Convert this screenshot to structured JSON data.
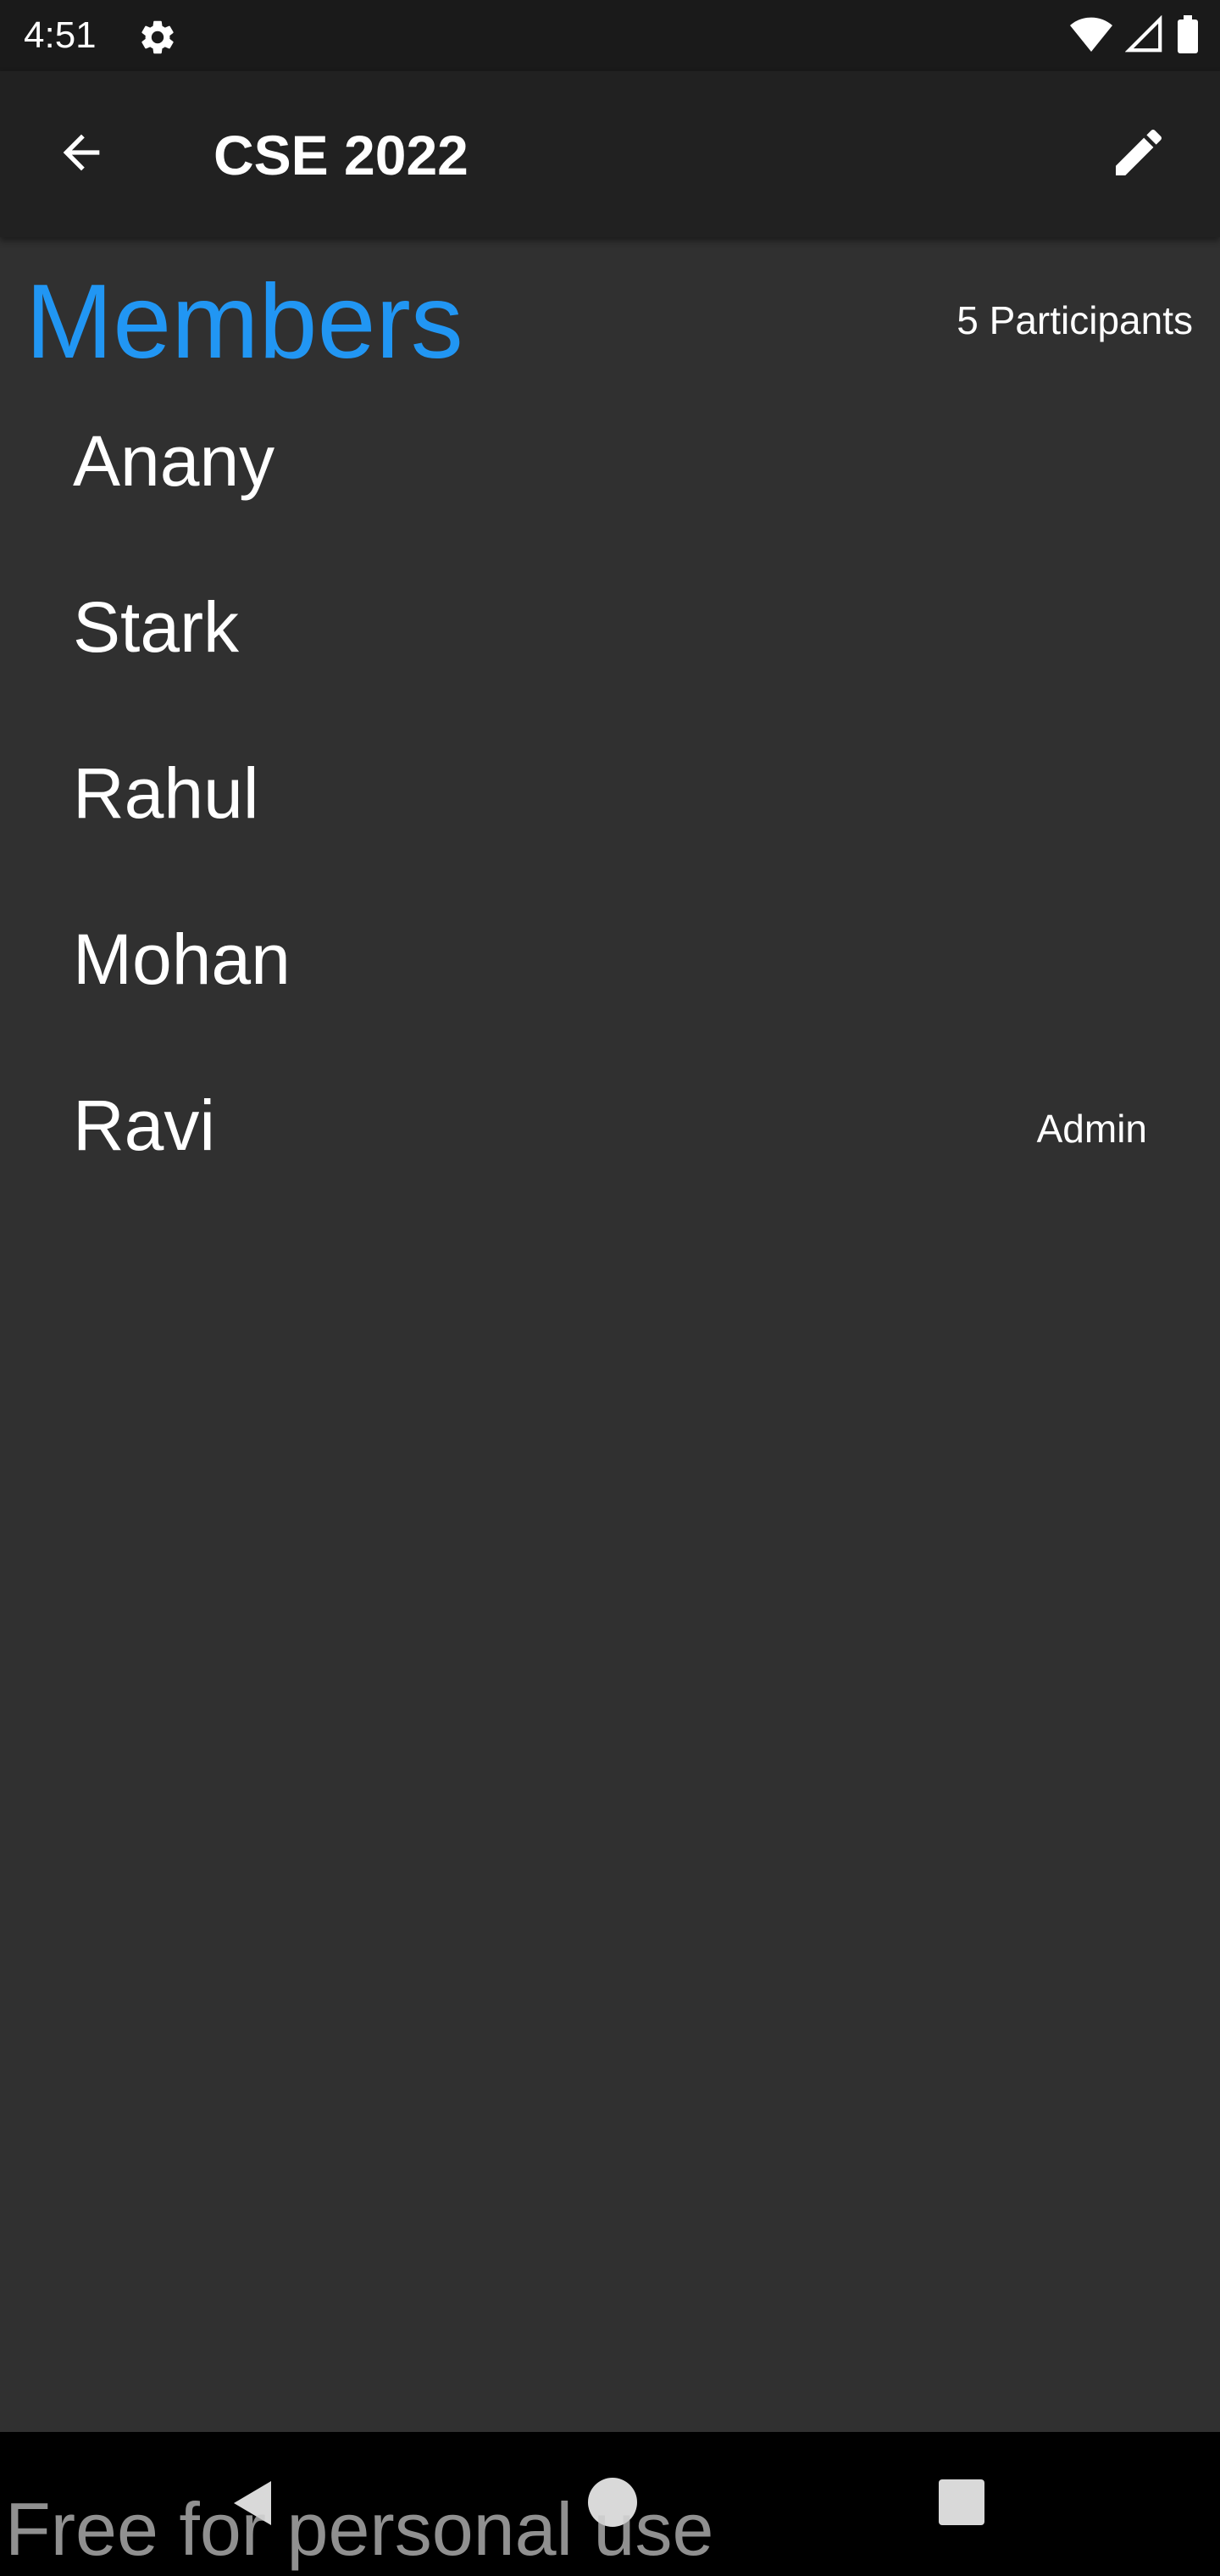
{
  "status_bar": {
    "time": "4:51",
    "icons": [
      "settings-gear-icon",
      "wifi-icon",
      "signal-icon",
      "battery-icon"
    ]
  },
  "app_bar": {
    "title": "CSE 2022",
    "back_icon": "arrow-back-icon",
    "edit_icon": "pencil-edit-icon"
  },
  "members": {
    "header": "Members",
    "count_label": "5 Participants",
    "list": [
      {
        "name": "Anany",
        "role": ""
      },
      {
        "name": "Stark",
        "role": ""
      },
      {
        "name": "Rahul",
        "role": ""
      },
      {
        "name": "Mohan",
        "role": ""
      },
      {
        "name": "Ravi",
        "role": "Admin"
      }
    ]
  },
  "nav_bar": {
    "icons": [
      "nav-back-icon",
      "nav-home-icon",
      "nav-recents-icon"
    ]
  },
  "watermark": "Free for personal use",
  "colors": {
    "accent": "#2196f3",
    "background": "#303030",
    "app_bar": "#212121",
    "status_bar": "#1a1a1a",
    "nav_bar": "#000000"
  }
}
